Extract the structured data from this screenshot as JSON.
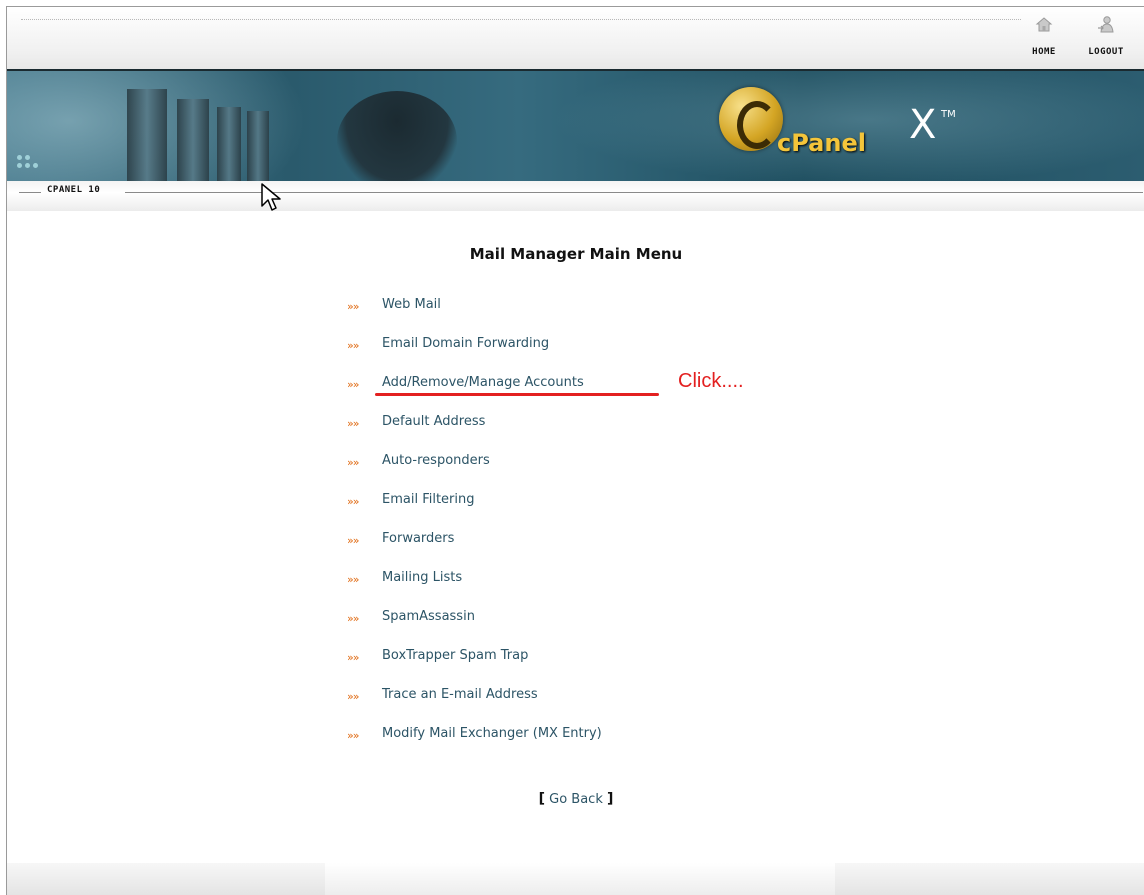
{
  "topnav": {
    "home_label": "HOME",
    "logout_label": "LOGOUT",
    "home_icon": "house-icon",
    "logout_icon": "user-logout-icon"
  },
  "banner": {
    "brand": "cPanel",
    "mark": "X",
    "tm": "TM"
  },
  "subbar": {
    "label": "CPANEL 10"
  },
  "main": {
    "title": "Mail Manager Main Menu",
    "menu_items": [
      "Web Mail",
      "Email Domain Forwarding",
      "Add/Remove/Manage Accounts",
      "Default Address",
      "Auto-responders",
      "Email Filtering",
      "Forwarders",
      "Mailing Lists",
      "SpamAssassin",
      "BoxTrapper Spam Trap",
      "Trace an E-mail Address",
      "Modify Mail Exchanger (MX Entry)"
    ],
    "bullet": "»»",
    "go_back_open": "[",
    "go_back_label": "Go Back",
    "go_back_close": "]"
  },
  "annotation": {
    "text": "Click....",
    "color": "#e32020"
  },
  "colors": {
    "link": "#2c5466",
    "bullet": "#e06a12",
    "banner": "#2a5a6c",
    "logo_gold": "#f4c53a"
  }
}
